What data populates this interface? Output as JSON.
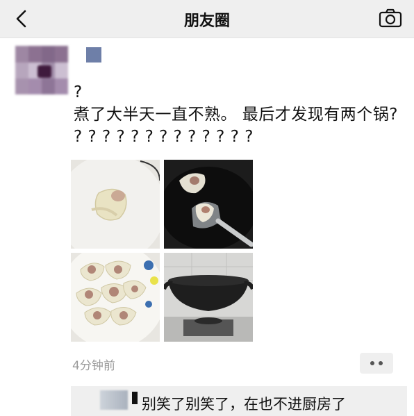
{
  "navbar": {
    "title": "朋友圈",
    "back_icon": "chevron-left-icon",
    "camera_icon": "camera-icon"
  },
  "post": {
    "text": "?\n煮了大半天一直不熟。 最后才发现有两个锅? ? ? ? ? ? ? ? ? ? ? ? ? ?",
    "photos": [
      "dumpling-photo",
      "spatula-dumplings-photo",
      "plate-dumplings-photo",
      "wok-on-stove-photo"
    ],
    "timestamp": "4分钟前"
  },
  "comment": {
    "text": "别笑了别笑了，在也不进厨房了"
  }
}
